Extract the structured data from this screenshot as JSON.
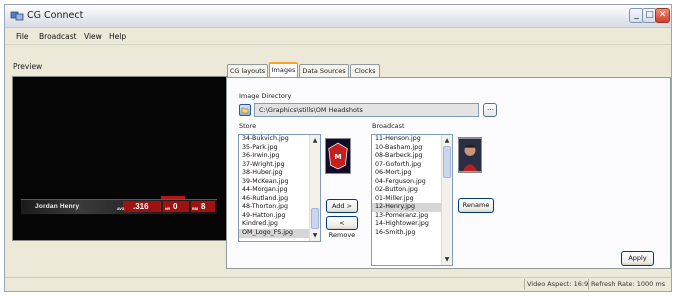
{
  "window": {
    "title": "CG Connect"
  },
  "menu": [
    "File",
    "Broadcast",
    "View",
    "Help"
  ],
  "preview": {
    "label": "Preview",
    "player_name": "Jordan Henry",
    "stats": [
      {
        "label": "AVG",
        "value": ".316"
      },
      {
        "label": "HR",
        "value": "0"
      },
      {
        "label": "RBI",
        "value": "8"
      }
    ]
  },
  "tabs": [
    "CG layouts",
    "Images",
    "Data Sources",
    "Clocks"
  ],
  "active_tab": "Images",
  "images": {
    "dir_label": "Image Directory",
    "dir_value": "C:\\Graphics\\stills\\OM Headshots",
    "store_label": "Store",
    "broadcast_label": "Broadcast",
    "store_items": [
      "34-Bukvich.jpg",
      "35-Park.jpg",
      "36-Irwin.jpg",
      "37-Wright.jpg",
      "38-Huber.jpg",
      "39-McKean.jpg",
      "44-Morgan.jpg",
      "46-Rutland.jpg",
      "48-Thorton.jpg",
      "49-Hatton.jpg",
      "Kindred.jpg",
      "OM_Logo_FS.jpg"
    ],
    "store_selected": 11,
    "broadcast_items": [
      "11-Henson.jpg",
      "10-Basham.jpg",
      "08-Barbeck.jpg",
      "07-Goforth.jpg",
      "06-Mort.jpg",
      "04-Ferguson.jpg",
      "02-Button.jpg",
      "01-Miller.jpg",
      "12-Henry.jpg",
      "13-Pomeranz.jpg",
      "14-Hightower.jpg",
      "16-Smith.jpg"
    ],
    "broadcast_selected": 8,
    "add_label": "Add >",
    "remove_label": "< Remove",
    "rename_label": "Rename",
    "apply_label": "Apply"
  },
  "status": {
    "video_aspect": "Video Aspect: 16:9",
    "refresh_rate": "Refresh Rate: 1000 ms"
  },
  "colors": {
    "stat_red": "#9e1212",
    "tab_accent": "#f5a623",
    "selection": "#d6d6d6"
  }
}
